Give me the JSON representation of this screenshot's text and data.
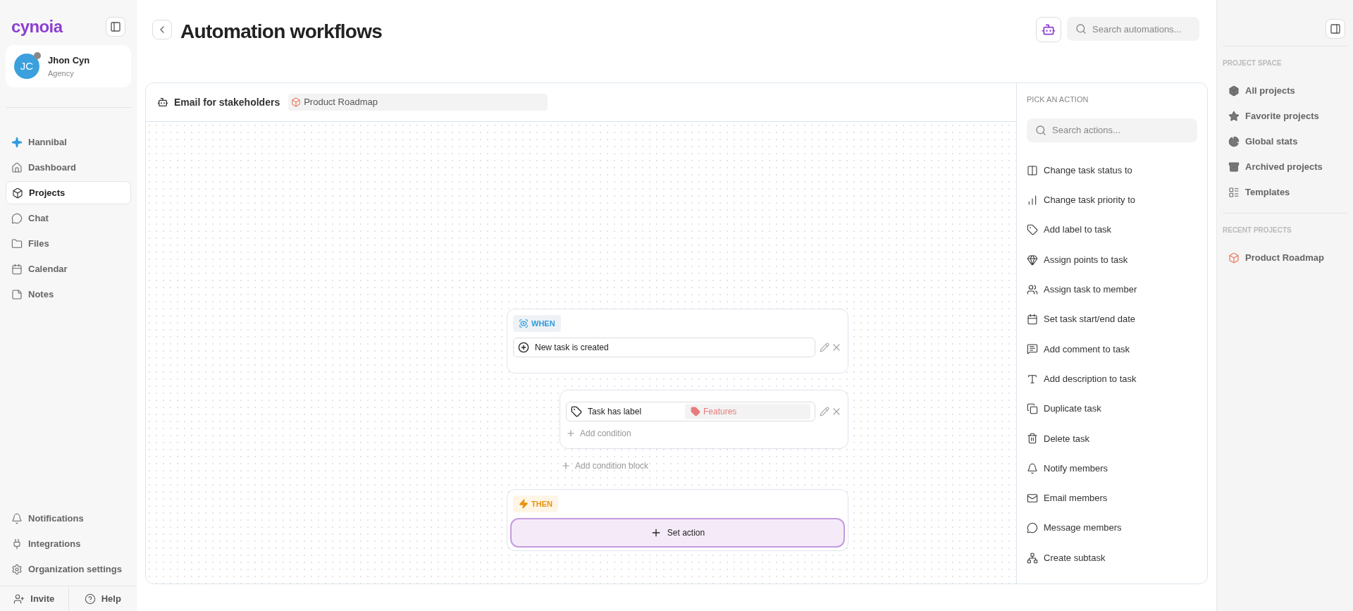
{
  "brand": {
    "logo": "cynoia"
  },
  "user": {
    "initials": "JC",
    "name": "Jhon Cyn",
    "role": "Agency",
    "online": false
  },
  "nav": [
    {
      "label": "Hannibal",
      "selected": false
    },
    {
      "label": "Dashboard",
      "selected": false
    },
    {
      "label": "Projects",
      "selected": true
    },
    {
      "label": "Chat",
      "selected": false
    },
    {
      "label": "Files",
      "selected": false
    },
    {
      "label": "Calendar",
      "selected": false
    },
    {
      "label": "Notes",
      "selected": false
    }
  ],
  "bottom_nav": [
    {
      "label": "Notifications"
    },
    {
      "label": "Integrations"
    },
    {
      "label": "Organization settings"
    }
  ],
  "footer": [
    {
      "label": "Invite"
    },
    {
      "label": "Help"
    }
  ],
  "page": {
    "title": "Automation workflows",
    "search_placeholder": "Search automations..."
  },
  "workflow": {
    "name": "Email for stakeholders",
    "project": "Product Roadmap"
  },
  "when": {
    "label": "WHEN",
    "trigger": "New task is created"
  },
  "condition": {
    "field": "Task has label",
    "value": "Features",
    "add": "Add condition"
  },
  "add_block": "Add condition block",
  "then": {
    "label": "THEN",
    "action": "Set action"
  },
  "actions_panel": {
    "title": "PICK AN ACTION",
    "search_placeholder": "Search actions...",
    "items": [
      {
        "label": "Change task status to"
      },
      {
        "label": "Change task priority to"
      },
      {
        "label": "Add label to task"
      },
      {
        "label": "Assign points to task"
      },
      {
        "label": "Assign task to member"
      },
      {
        "label": "Set task start/end date"
      },
      {
        "label": "Add comment to task"
      },
      {
        "label": "Add description to task"
      },
      {
        "label": "Duplicate task"
      },
      {
        "label": "Delete task"
      },
      {
        "label": "Notify members"
      },
      {
        "label": "Email members"
      },
      {
        "label": "Message members"
      },
      {
        "label": "Create subtask"
      }
    ]
  },
  "right_sidebar": {
    "project_space_title": "PROJECT SPACE",
    "items": [
      {
        "label": "All projects"
      },
      {
        "label": "Favorite projects"
      },
      {
        "label": "Global stats"
      },
      {
        "label": "Archived projects"
      },
      {
        "label": "Templates"
      }
    ],
    "recent_title": "RECENT PROJECTS",
    "recent": [
      {
        "label": "Product Roadmap"
      }
    ]
  }
}
